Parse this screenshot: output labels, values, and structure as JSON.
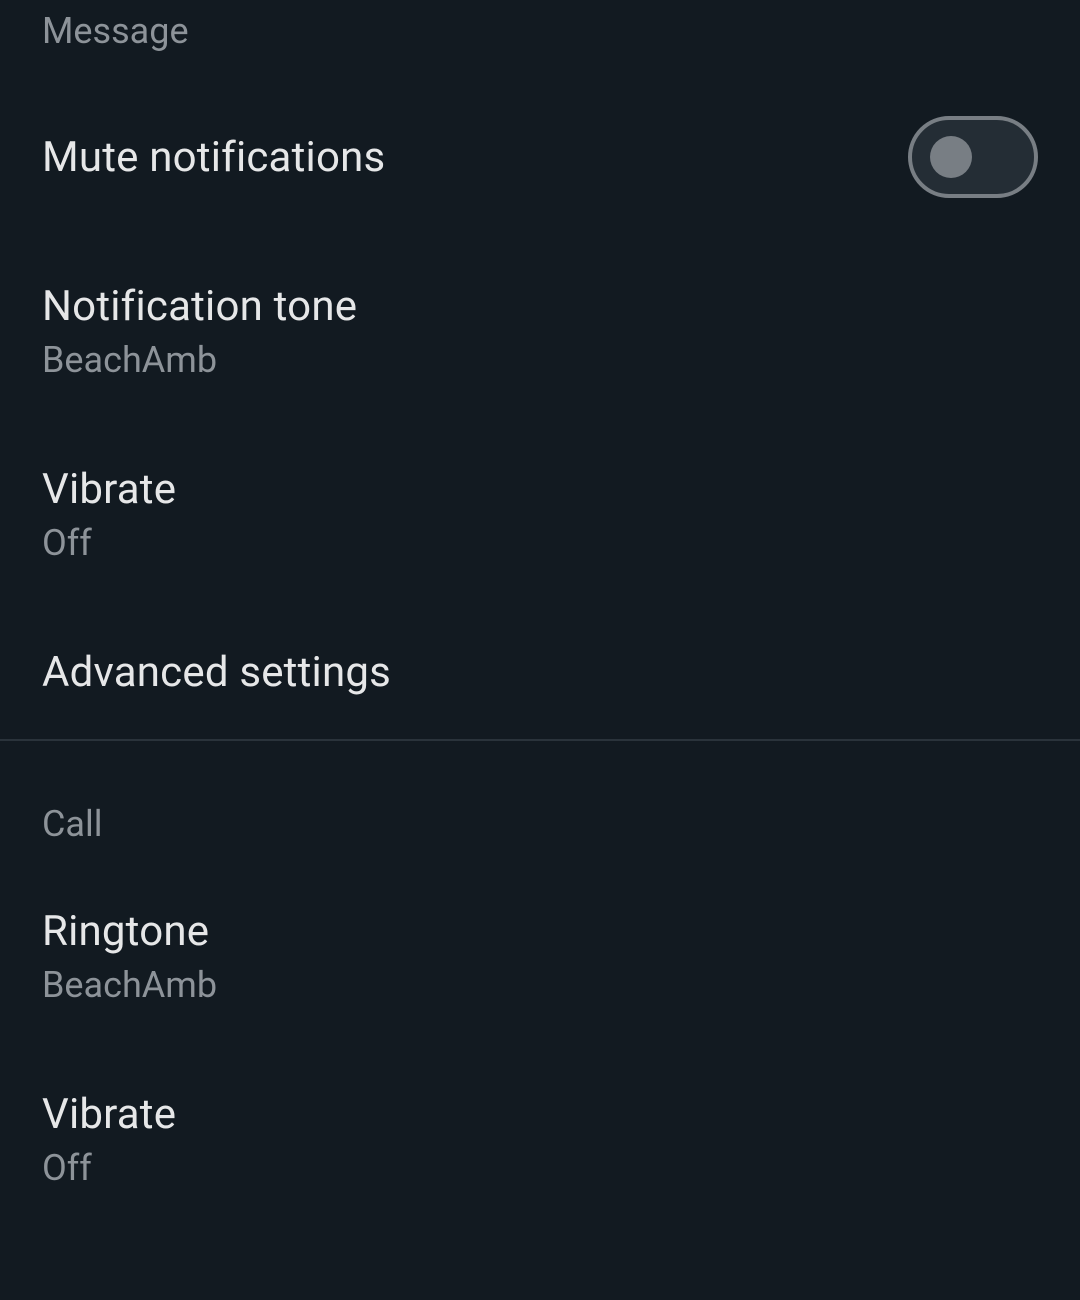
{
  "message_section": {
    "header": "Message",
    "mute_notifications": {
      "label": "Mute notifications",
      "enabled": false
    },
    "notification_tone": {
      "label": "Notification tone",
      "value": "BeachAmb"
    },
    "vibrate": {
      "label": "Vibrate",
      "value": "Off"
    },
    "advanced_settings": {
      "label": "Advanced settings"
    }
  },
  "call_section": {
    "header": "Call",
    "ringtone": {
      "label": "Ringtone",
      "value": "BeachAmb"
    },
    "vibrate": {
      "label": "Vibrate",
      "value": "Off"
    }
  }
}
